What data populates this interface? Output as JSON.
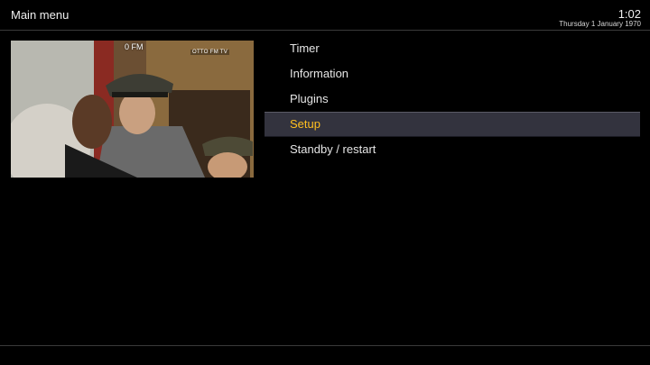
{
  "header": {
    "title": "Main menu",
    "time": "1:02",
    "date": "Thursday  1 January 1970"
  },
  "preview": {
    "osd_time": "0 FM",
    "channel_logo": "OTTO FM TV"
  },
  "menu": {
    "selected_index": 3,
    "items": [
      {
        "label": "Timer"
      },
      {
        "label": "Information"
      },
      {
        "label": "Plugins"
      },
      {
        "label": "Setup"
      },
      {
        "label": "Standby / restart"
      }
    ]
  },
  "colors": {
    "background": "#000000",
    "selected_text": "#ffbf1f",
    "selected_bg": "#33333e",
    "text": "#e6e6e6"
  }
}
